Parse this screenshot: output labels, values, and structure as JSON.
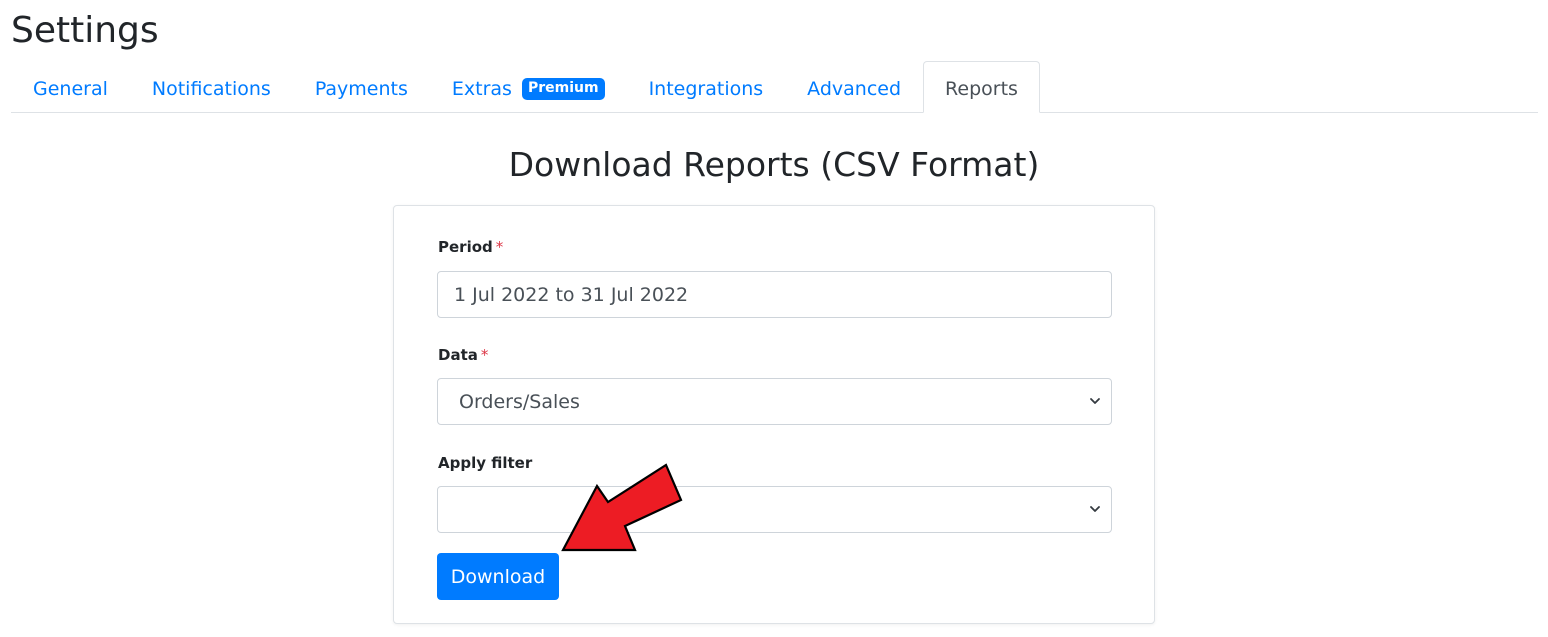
{
  "page": {
    "title": "Settings"
  },
  "tabs": [
    {
      "label": "General"
    },
    {
      "label": "Notifications"
    },
    {
      "label": "Payments"
    },
    {
      "label": "Extras",
      "badge": "Premium"
    },
    {
      "label": "Integrations"
    },
    {
      "label": "Advanced"
    },
    {
      "label": "Reports",
      "active": true
    }
  ],
  "reports": {
    "heading": "Download Reports (CSV Format)",
    "period": {
      "label": "Period",
      "required_mark": "*",
      "value": "1 Jul 2022 to 31 Jul 2022"
    },
    "data": {
      "label": "Data",
      "required_mark": "*",
      "selected": "Orders/Sales"
    },
    "filter": {
      "label": "Apply filter",
      "selected": ""
    },
    "download_label": "Download"
  },
  "annotation": {
    "arrow_color": "#ed1c24",
    "arrow_icon": "red-arrow-pointer"
  },
  "colors": {
    "accent": "#007bff",
    "required": "#dc3545"
  }
}
